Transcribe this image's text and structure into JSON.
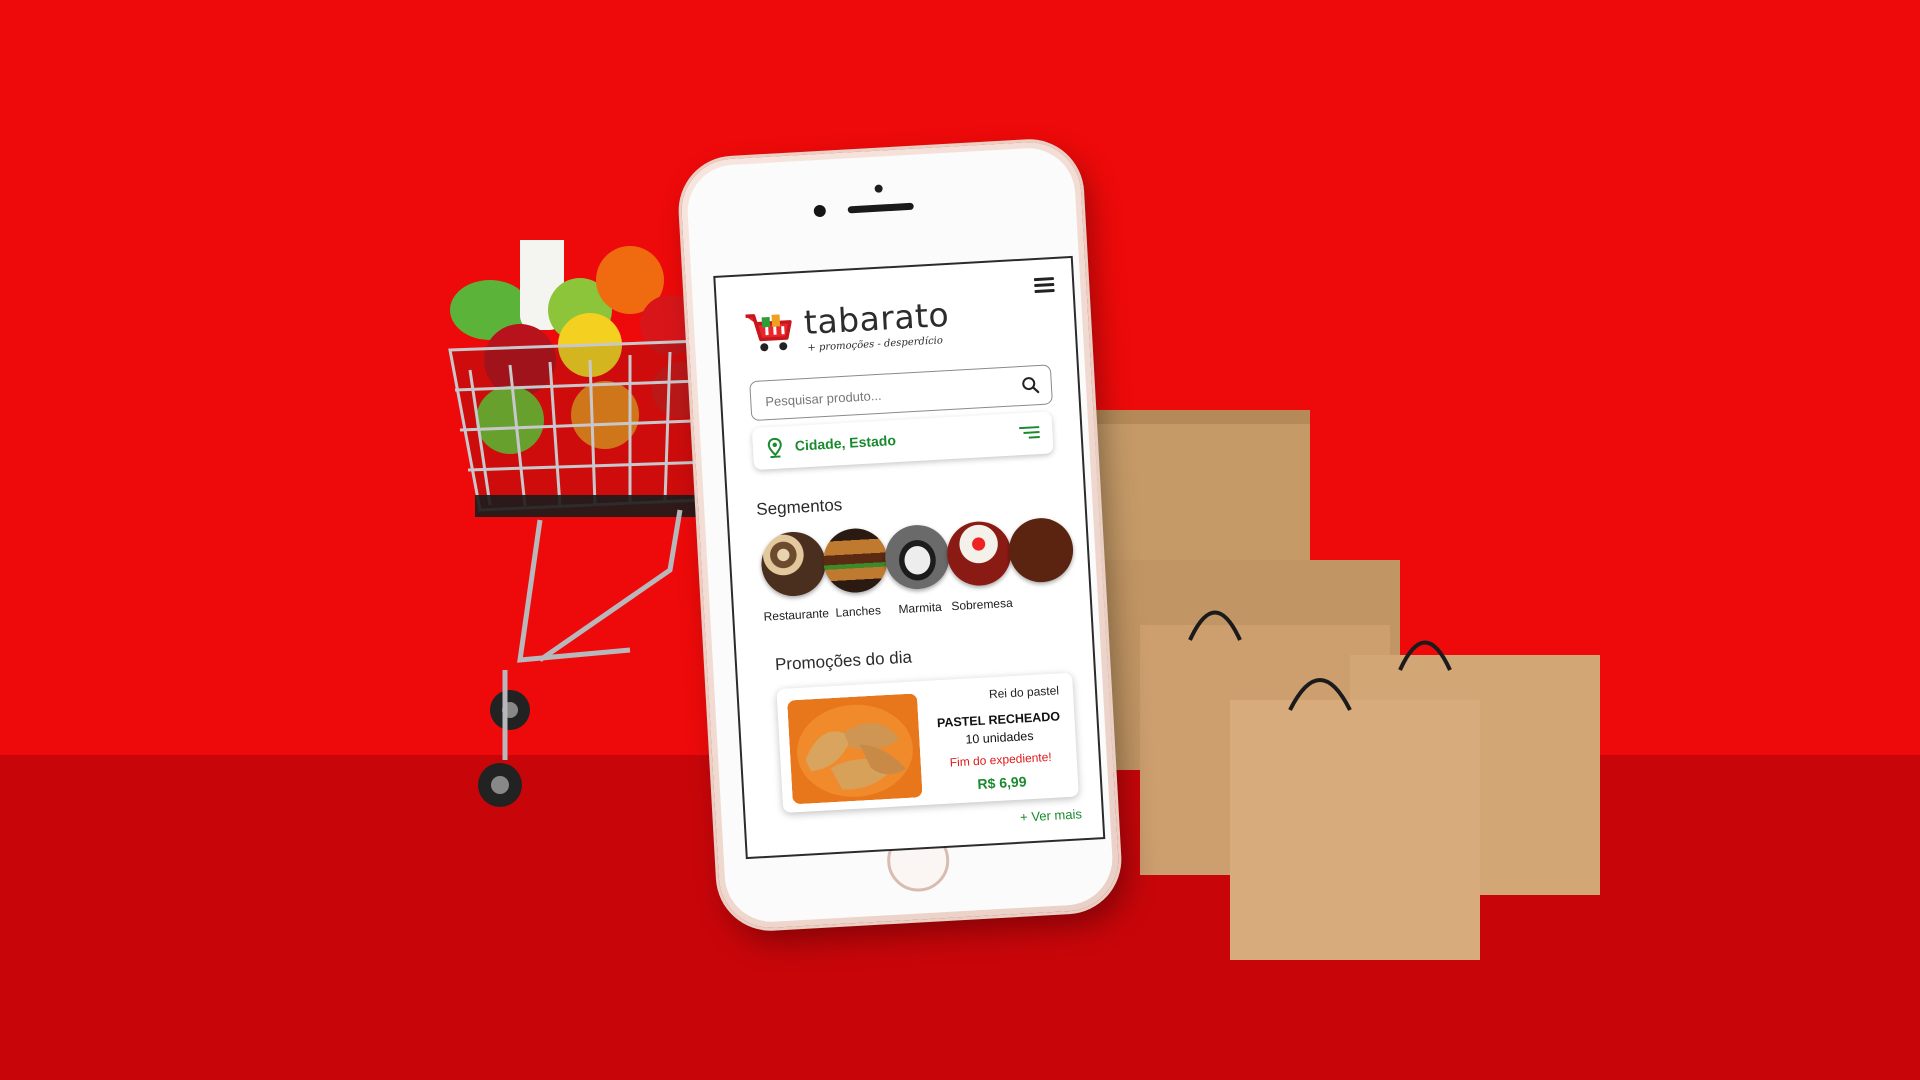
{
  "app": {
    "brand_name": "tabarato",
    "tagline": "+ promoções - desperdício"
  },
  "search": {
    "placeholder": "Pesquisar produto..."
  },
  "location": {
    "label": "Cidade, Estado"
  },
  "segments": {
    "title": "Segmentos",
    "items": [
      {
        "label": "Restaurante"
      },
      {
        "label": "Lanches"
      },
      {
        "label": "Marmita"
      },
      {
        "label": "Sobremesa"
      }
    ]
  },
  "promotions": {
    "title": "Promoções do dia",
    "card": {
      "store": "Rei do pastel",
      "product": "PASTEL RECHEADO",
      "quantity": "10 unidades",
      "badge": "Fim do expediente!",
      "price": "R$ 6,99"
    },
    "see_more": "+ Ver mais"
  },
  "colors": {
    "background": "#ee0a0a",
    "floor": "#c8060a",
    "accent_green": "#1a8a2e",
    "alert_red": "#e01818"
  },
  "icons": [
    "menu-icon",
    "search-icon",
    "location-pin-icon",
    "filter-icon",
    "cart-logo-icon"
  ]
}
